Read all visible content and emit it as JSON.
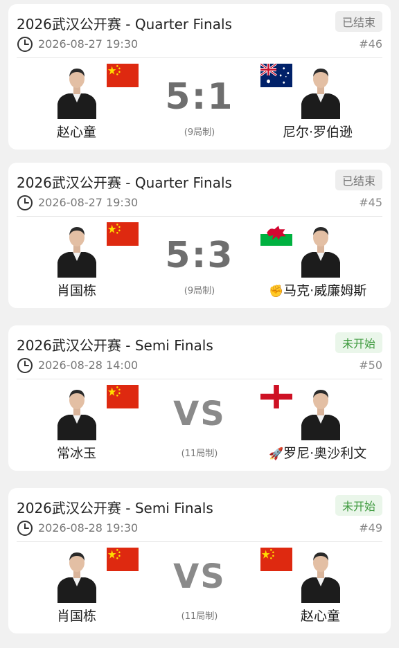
{
  "matches": [
    {
      "title": "2026武汉公开赛 - Quarter Finals",
      "status": "已结束",
      "time": "2026-08-27 19:30",
      "number": "#46",
      "left": {
        "name": "赵心童",
        "flag": "china"
      },
      "right": {
        "name": "尼尔·罗伯逊",
        "flag": "australia"
      },
      "score": "5:1",
      "format": "(9局制)"
    },
    {
      "title": "2026武汉公开赛 - Quarter Finals",
      "status": "已结束",
      "time": "2026-08-27 19:30",
      "number": "#45",
      "left": {
        "name": "肖国栋",
        "flag": "china"
      },
      "right": {
        "name": "马克·威廉姆斯",
        "flag": "wales",
        "icon": "fist-icon"
      },
      "score": "5:3",
      "format": "(9局制)"
    },
    {
      "title": "2026武汉公开赛 - Semi Finals",
      "status": "未开始",
      "time": "2026-08-28 14:00",
      "number": "#50",
      "left": {
        "name": "常冰玉",
        "flag": "china"
      },
      "right": {
        "name": "罗尼·奥沙利文",
        "flag": "england",
        "icon": "rocket-icon"
      },
      "score": "VS",
      "format": "(11局制)"
    },
    {
      "title": "2026武汉公开赛 - Semi Finals",
      "status": "未开始",
      "time": "2026-08-28 19:30",
      "number": "#49",
      "left": {
        "name": "肖国栋",
        "flag": "china"
      },
      "right": {
        "name": "赵心童",
        "flag": "china"
      },
      "score": "VS",
      "format": "(11局制)"
    }
  ],
  "colors": {
    "finished_badge_bg": "#eeeeee",
    "pending_badge_bg": "#eaf6ea",
    "pending_badge_text": "#3e9a3e",
    "china_red": "#de2910",
    "china_yellow": "#ffde00"
  }
}
